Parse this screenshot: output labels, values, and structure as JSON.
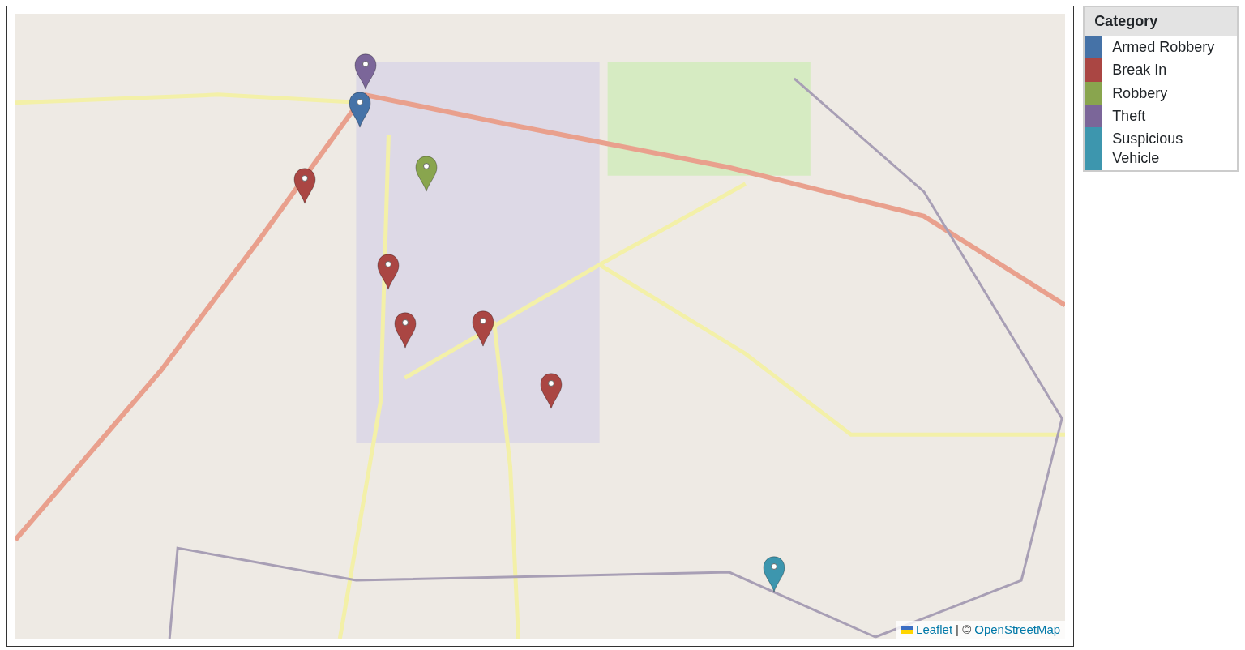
{
  "map": {
    "markers": [
      {
        "color": "#7b6699"
      },
      {
        "color": "#4572a7"
      },
      {
        "color": "#89a54e"
      },
      {
        "color": "#aa4643"
      },
      {
        "color": "#aa4643"
      },
      {
        "color": "#aa4643"
      },
      {
        "color": "#aa4643"
      },
      {
        "color": "#aa4643"
      },
      {
        "color": "#3d96ae"
      }
    ],
    "attribution": {
      "leaflet_link": "Leaflet",
      "separator": "| ©",
      "osm_link": "OpenStreetMap"
    }
  },
  "legend": {
    "title": "Category",
    "items": [
      {
        "label": "Armed Robbery",
        "color": "#4572a7"
      },
      {
        "label": "Break In",
        "color": "#aa4643"
      },
      {
        "label": "Robbery",
        "color": "#89a54e"
      },
      {
        "label": "Theft",
        "color": "#7b6699"
      },
      {
        "label": "Suspicious Vehicle",
        "color": "#3d96ae"
      }
    ]
  }
}
